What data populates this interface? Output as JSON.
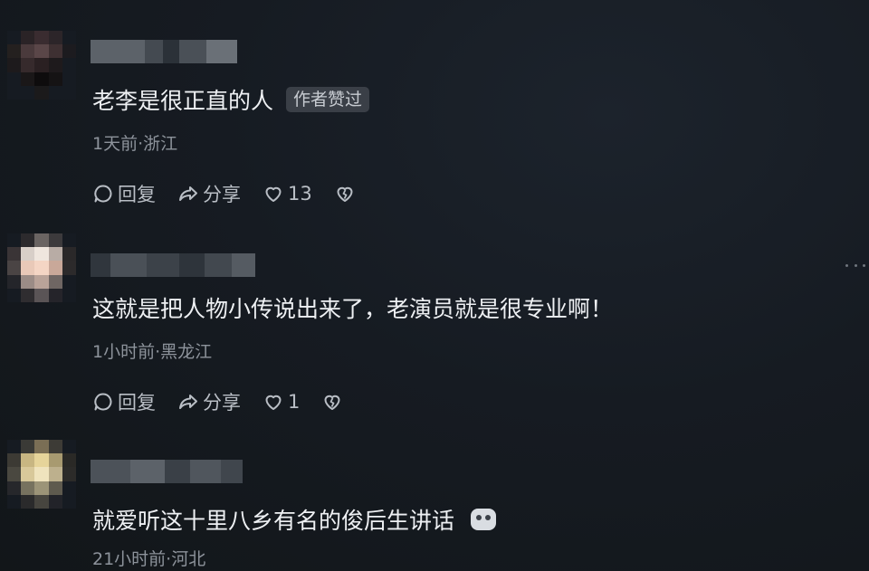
{
  "comments": [
    {
      "text": "老李是很正直的人",
      "badge": "作者赞过",
      "time_location": "1天前·浙江",
      "reply_label": "回复",
      "share_label": "分享",
      "like_count": "13",
      "icons": [
        "reply-icon",
        "share-icon",
        "heart-icon",
        "broken-heart-icon"
      ]
    },
    {
      "text": "这就是把人物小传说出来了，老演员就是很专业啊！",
      "time_location": "1小时前·黑龙江",
      "reply_label": "回复",
      "share_label": "分享",
      "like_count": "1",
      "icons": [
        "reply-icon",
        "share-icon",
        "heart-icon",
        "broken-heart-icon"
      ]
    },
    {
      "text": "就爱听这十里八乡有名的俊后生讲话",
      "emoji": "smile-emoji-icon",
      "time_location": "21小时前·河北"
    }
  ],
  "colors": {
    "background": "#161b22",
    "text": "#eef0f3",
    "meta": "#8d939b",
    "badge_bg": "#3a3f47"
  }
}
